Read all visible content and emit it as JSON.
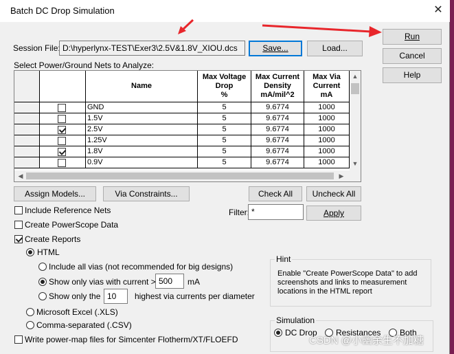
{
  "window": {
    "title": "Batch DC Drop Simulation",
    "close_glyph": "✕"
  },
  "session": {
    "label": "Session File:",
    "value": "D:\\hyperlynx-TEST\\Exer3\\2.5V&1.8V_XIOU.dcs",
    "save_label": "Save...",
    "load_label": "Load..."
  },
  "side_buttons": {
    "run": "Run",
    "cancel": "Cancel",
    "help": "Help"
  },
  "nets": {
    "label": "Select Power/Ground Nets to Analyze:",
    "columns": [
      "Name",
      "Max Voltage Drop %",
      "Max Current Density mA/mil^2",
      "Max Via Current mA"
    ],
    "col_lines": [
      [
        "Name"
      ],
      [
        "Max Voltage",
        "Drop",
        "%"
      ],
      [
        "Max Current",
        "Density",
        "mA/mil^2"
      ],
      [
        "Max Via",
        "Current",
        "mA"
      ]
    ],
    "rows": [
      {
        "checked": false,
        "name": "GND",
        "drop": "5",
        "density": "9.6774",
        "via": "1000"
      },
      {
        "checked": false,
        "name": "1.5V",
        "drop": "5",
        "density": "9.6774",
        "via": "1000"
      },
      {
        "checked": true,
        "name": "2.5V",
        "drop": "5",
        "density": "9.6774",
        "via": "1000"
      },
      {
        "checked": false,
        "name": "1.25V",
        "drop": "5",
        "density": "9.6774",
        "via": "1000"
      },
      {
        "checked": true,
        "name": "1.8V",
        "drop": "5",
        "density": "9.6774",
        "via": "1000"
      },
      {
        "checked": false,
        "name": "0.9V",
        "drop": "5",
        "density": "9.6774",
        "via": "1000"
      }
    ]
  },
  "actions": {
    "assign_models": "Assign Models...",
    "via_constraints": "Via Constraints...",
    "check_all": "Check All",
    "uncheck_all": "Uncheck All"
  },
  "filter": {
    "label": "Filter:",
    "value": "*",
    "apply": "Apply"
  },
  "options": {
    "include_ref_nets": {
      "label": "Include Reference Nets",
      "checked": false
    },
    "create_powerscope": {
      "label": "Create PowerScope Data",
      "checked": false
    },
    "create_reports": {
      "label": "Create Reports",
      "checked": true
    },
    "html": {
      "label": "HTML",
      "selected": true
    },
    "include_all_vias": {
      "label": "Include all vias (not recommended for big designs)",
      "selected": false
    },
    "show_only_current": {
      "label": "Show only vias with current >",
      "value": "500",
      "unit": "mA",
      "selected": true
    },
    "show_only_the": {
      "label": "Show only the",
      "value": "10",
      "suffix": "highest via currents per diameter",
      "selected": false
    },
    "excel": {
      "label": "Microsoft Excel (.XLS)",
      "selected": false
    },
    "csv": {
      "label": "Comma-separated (.CSV)",
      "selected": false
    },
    "power_map": {
      "label": "Write power-map files for Simcenter Flotherm/XT/FLOEFD",
      "checked": false
    }
  },
  "hint": {
    "title": "Hint",
    "text": "Enable \"Create PowerScope Data\" to add screenshots and links to measurement locations in the HTML report"
  },
  "simulation": {
    "title": "Simulation",
    "dc_drop": "DC Drop",
    "resistances": "Resistances",
    "both": "Both",
    "selected": "DC Drop"
  },
  "watermark": "CSDN @小幽余生不加糖",
  "colors": {
    "arrow": "#e8262b",
    "accent": "#0078d7",
    "background": "#7a1f52"
  }
}
